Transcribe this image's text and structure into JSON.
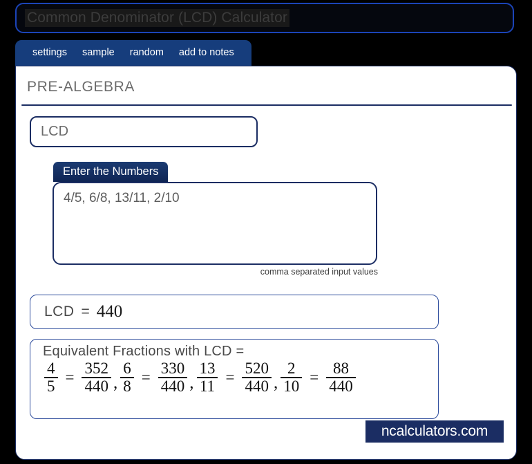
{
  "window": {
    "title": "Common Denominator (LCD) Calculator"
  },
  "nav": {
    "items": [
      {
        "label": "settings",
        "name": "nav-item-settings"
      },
      {
        "label": "sample",
        "name": "nav-item-sample"
      },
      {
        "label": "random",
        "name": "nav-item-random"
      },
      {
        "label": "add to notes",
        "name": "nav-item-add-to-notes"
      }
    ]
  },
  "panel": {
    "category": "PRE-ALGEBRA",
    "calculator_select": {
      "value": "LCD"
    },
    "input_group": {
      "legend": "Enter the Numbers",
      "value": "4/5, 6/8, 13/11, 2/10",
      "hint": "comma separated input values"
    },
    "result": {
      "label": "LCD",
      "equals": "=",
      "value": "440"
    },
    "equivalent": {
      "title": "Equivalent Fractions with LCD  =",
      "equals": "=",
      "separator": ",",
      "pairs": [
        {
          "from_num": "4",
          "from_den": "5",
          "to_num": "352",
          "to_den": "440"
        },
        {
          "from_num": "6",
          "from_den": "8",
          "to_num": "330",
          "to_den": "440"
        },
        {
          "from_num": "13",
          "from_den": "11",
          "to_num": "520",
          "to_den": "440"
        },
        {
          "from_num": "2",
          "from_den": "10",
          "to_num": "88",
          "to_den": "440"
        }
      ]
    },
    "brand": "ncalculators.com"
  },
  "colors": {
    "page_background": "#000000",
    "navy": "#1b2d63",
    "nav_blue": "#163d7c",
    "title_border": "#1b44b8",
    "panel_background": "#ffffff",
    "muted_text": "#6b6b6b"
  }
}
